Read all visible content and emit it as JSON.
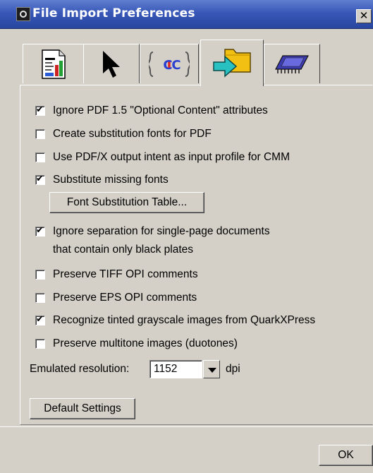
{
  "window": {
    "title": "File Import Preferences",
    "close_glyph": "✕"
  },
  "tabs": [
    {
      "name": "document-tab",
      "icon": "document-chart-icon",
      "active": false
    },
    {
      "name": "pointer-tab",
      "icon": "arrow-pointer-icon",
      "active": false
    },
    {
      "name": "icc-tab",
      "icon": "icc-profile-icon",
      "icon_text": "ICC",
      "active": false
    },
    {
      "name": "import-tab",
      "icon": "folder-import-arrow-icon",
      "active": true
    },
    {
      "name": "hardware-tab",
      "icon": "memory-chip-icon",
      "active": false
    }
  ],
  "options": [
    {
      "label": "Ignore PDF 1.5 \"Optional Content\" attributes",
      "checked": true
    },
    {
      "label": "Create substitution fonts for PDF",
      "checked": false
    },
    {
      "label": "Use PDF/X output intent as input profile for CMM",
      "checked": false
    },
    {
      "label": "Substitute missing fonts",
      "checked": true
    },
    {
      "label": "Ignore separation for single-page documents",
      "label_line2": "that contain only black plates",
      "checked": true
    },
    {
      "label": "Preserve TIFF OPI comments",
      "checked": false
    },
    {
      "label": "Preserve EPS OPI comments",
      "checked": false
    },
    {
      "label": "Recognize tinted grayscale images from QuarkXPress",
      "checked": true
    },
    {
      "label": "Preserve multitone images (duotones)",
      "checked": false
    }
  ],
  "font_substitution_button": "Font Substitution Table...",
  "resolution": {
    "label": "Emulated resolution:",
    "value": "1152",
    "unit": "dpi"
  },
  "default_settings_button": "Default Settings",
  "ok_button": "OK",
  "colors": {
    "titlebar": "#3857b8",
    "face": "#d4d0c8"
  }
}
